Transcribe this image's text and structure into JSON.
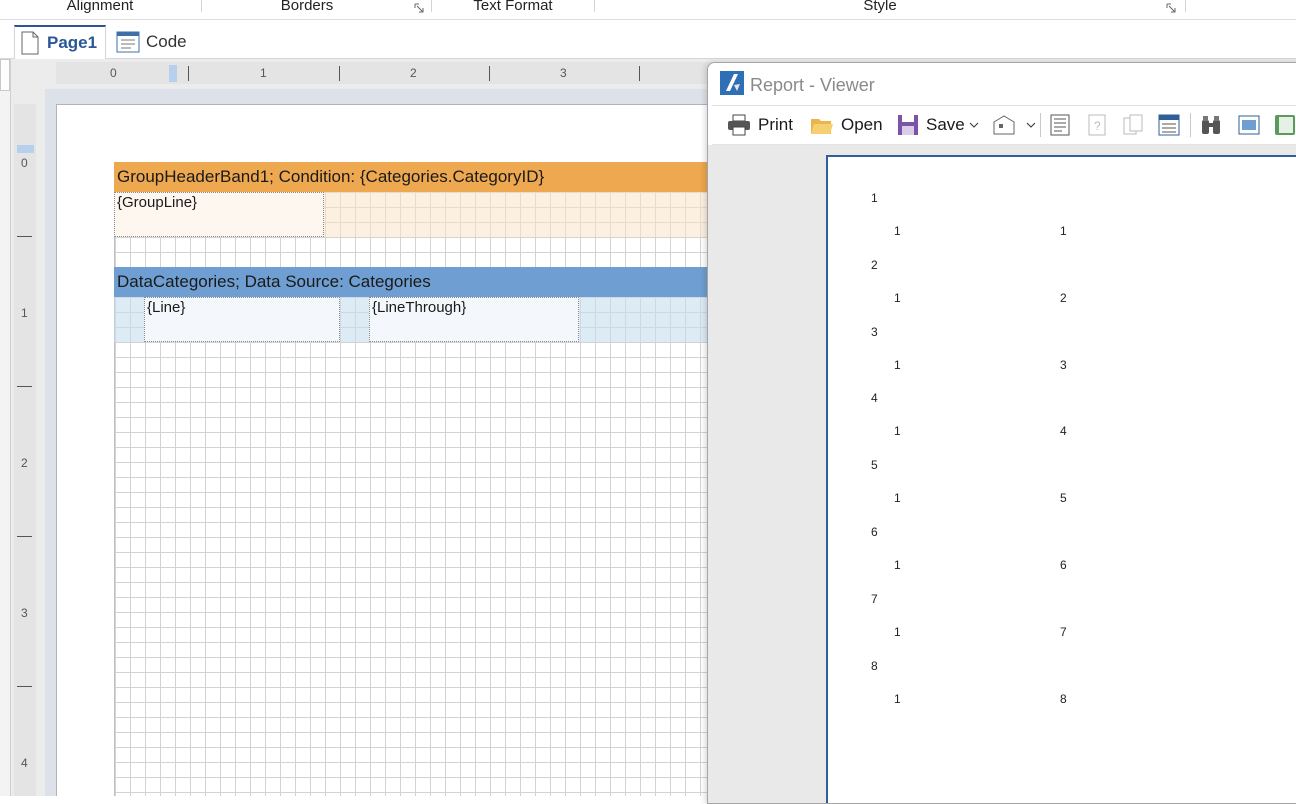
{
  "ribbon": {
    "groups": [
      "Alignment",
      "Borders",
      "Text Format",
      "Style"
    ]
  },
  "tabs": {
    "page1": "Page1",
    "code": "Code"
  },
  "ruler": {
    "h_labels": [
      "0",
      "1",
      "2",
      "3"
    ],
    "v_labels": [
      "0",
      "1",
      "2",
      "3",
      "4"
    ]
  },
  "bands": {
    "group_header_title": "GroupHeaderBand1; Condition: {Categories.CategoryID}",
    "group_line": "{GroupLine}",
    "data_title": "DataCategories; Data Source: Categories",
    "line": "{Line}",
    "line_through": "{LineThrough}"
  },
  "viewer": {
    "title": "Report - Viewer",
    "toolbar": {
      "print": "Print",
      "open": "Open",
      "save": "Save"
    },
    "rows": [
      {
        "group": "1",
        "a": "1",
        "b": "1"
      },
      {
        "group": "2",
        "a": "1",
        "b": "2"
      },
      {
        "group": "3",
        "a": "1",
        "b": "3"
      },
      {
        "group": "4",
        "a": "1",
        "b": "4"
      },
      {
        "group": "5",
        "a": "1",
        "b": "5"
      },
      {
        "group": "6",
        "a": "1",
        "b": "6"
      },
      {
        "group": "7",
        "a": "1",
        "b": "7"
      },
      {
        "group": "8",
        "a": "1",
        "b": "8"
      }
    ]
  },
  "colors": {
    "group_header": "#eea84f",
    "data_band": "#6f9fd2",
    "accent": "#2b579a"
  }
}
